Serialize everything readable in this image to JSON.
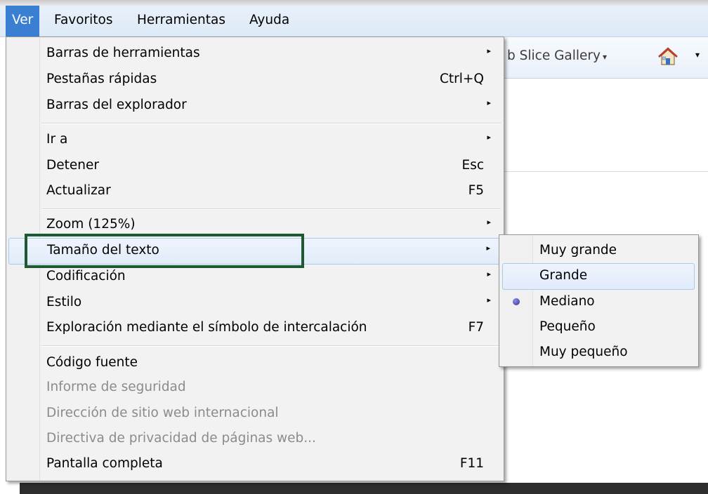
{
  "menubar": {
    "items": [
      {
        "label": "Ver",
        "active": true
      },
      {
        "label": "Favoritos"
      },
      {
        "label": "Herramientas"
      },
      {
        "label": "Ayuda"
      }
    ]
  },
  "commandbar": {
    "webslice_label": "b Slice Gallery",
    "dropdown_glyph": "▾",
    "home_icon": "home-icon"
  },
  "view_menu": {
    "items": [
      {
        "label": "Barras de herramientas",
        "shortcut": "",
        "submenu": true
      },
      {
        "label": "Pestañas rápidas",
        "shortcut": "Ctrl+Q",
        "submenu": false
      },
      {
        "label": "Barras del explorador",
        "shortcut": "",
        "submenu": true
      },
      {
        "label": "Ir a",
        "shortcut": "",
        "submenu": true
      },
      {
        "label": "Detener",
        "shortcut": "Esc",
        "submenu": false
      },
      {
        "label": "Actualizar",
        "shortcut": "F5",
        "submenu": false
      },
      {
        "label": "Zoom (125%)",
        "shortcut": "",
        "submenu": true
      },
      {
        "label": "Tamaño del texto",
        "shortcut": "",
        "submenu": true,
        "highlighted": true
      },
      {
        "label": "Codificación",
        "shortcut": "",
        "submenu": true
      },
      {
        "label": "Estilo",
        "shortcut": "",
        "submenu": true
      },
      {
        "label": "Exploración mediante el símbolo de intercalación",
        "shortcut": "F7",
        "submenu": false
      },
      {
        "label": "Código fuente",
        "shortcut": "",
        "submenu": false
      },
      {
        "label": "Informe de seguridad",
        "shortcut": "",
        "submenu": false,
        "disabled": true
      },
      {
        "label": "Dirección de sitio web internacional",
        "shortcut": "",
        "submenu": false,
        "disabled": true
      },
      {
        "label": "Directiva de privacidad de páginas web...",
        "shortcut": "",
        "submenu": false,
        "disabled": true
      },
      {
        "label": "Pantalla completa",
        "shortcut": "F11",
        "submenu": false
      }
    ],
    "submenu_arrow": "▸"
  },
  "text_size_submenu": {
    "items": [
      {
        "label": "Muy grande"
      },
      {
        "label": "Grande",
        "highlighted": true
      },
      {
        "label": "Mediano",
        "selected": true
      },
      {
        "label": "Pequeño"
      },
      {
        "label": "Muy pequeño"
      }
    ]
  },
  "colors": {
    "menubar_active": "#3a7fd1",
    "highlight_box": "#1d5a32",
    "radio": "#4040b0"
  }
}
